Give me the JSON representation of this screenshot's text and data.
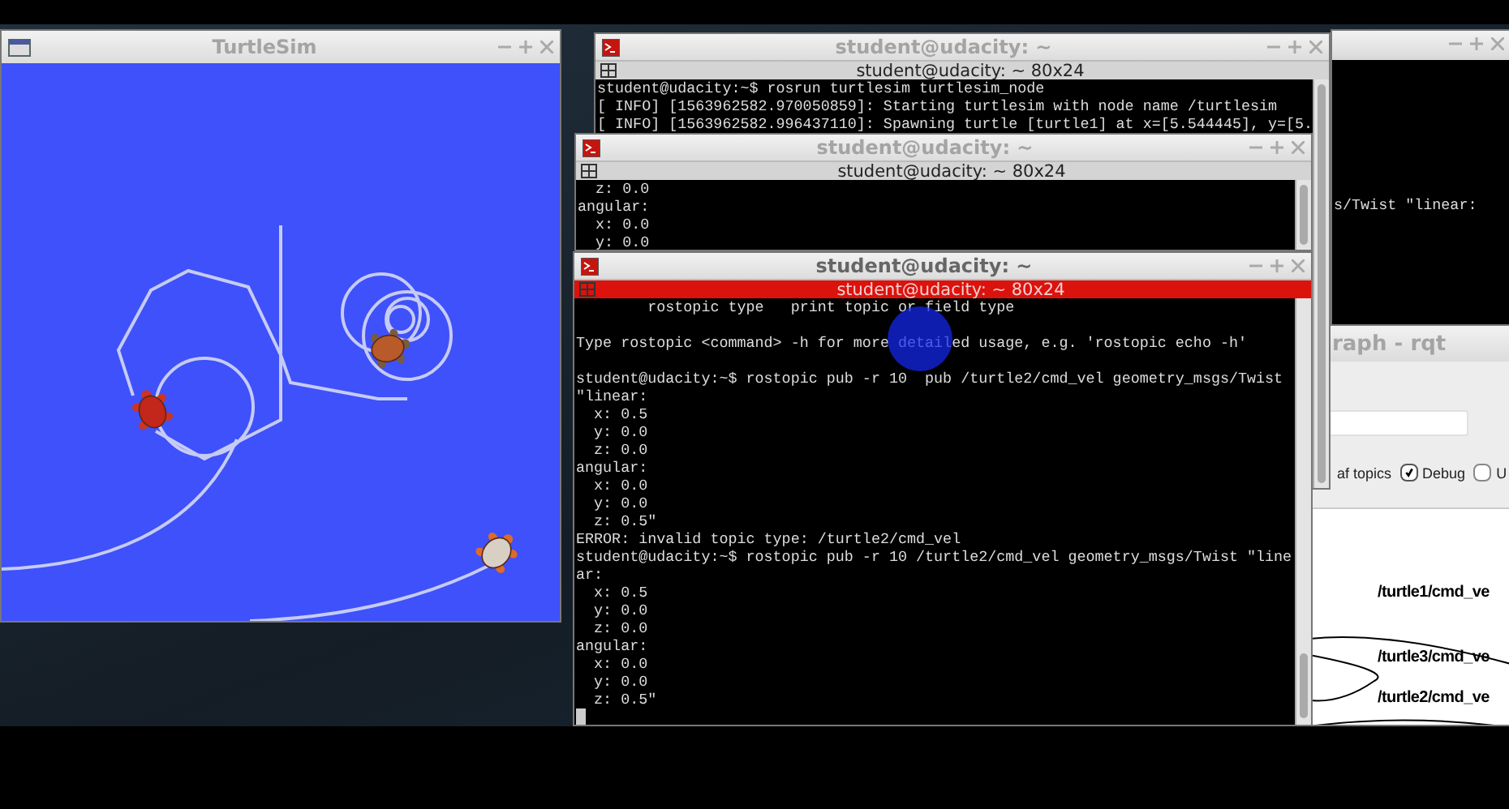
{
  "turtlesim": {
    "title": "TurtleSim",
    "focused": false
  },
  "background_terminal": {
    "lines": [
      "s/Twist \"linear:"
    ]
  },
  "rqt": {
    "title": "raph - rqt",
    "hide_label_partial": "af topics",
    "checkboxes": [
      {
        "label": "Debug",
        "checked": true
      },
      {
        "label": "U",
        "checked": false
      }
    ],
    "graph_nodes": [
      "/turtle1/cmd_ve",
      "/turtle3/cmd_ve",
      "/turtle2/cmd_ve"
    ]
  },
  "terminals": [
    {
      "title": "student@udacity: ~",
      "tab_title": "student@udacity: ~ 80x24",
      "focused": false,
      "paragraphs": [
        [
          "student@udacity:~$ rosrun turtlesim turtlesim_node",
          "[ INFO] [1563962582.970050859]: Starting turtlesim with node name /turtlesim",
          "[ INFO] [1563962582.996437110]: Spawning turtle [turtle1] at x=[5.544445], y=[5."
        ]
      ]
    },
    {
      "title": "student@udacity: ~",
      "tab_title": "student@udacity: ~ 80x24",
      "focused": false,
      "paragraphs": [
        [
          "  z: 0.0",
          "angular:",
          "  x: 0.0",
          "  y: 0.0"
        ]
      ]
    },
    {
      "title": "student@udacity: ~",
      "tab_title": "student@udacity: ~ 80x24",
      "focused": true,
      "paragraphs": [
        [
          "        rostopic type   print topic or field type"
        ],
        [
          "Type rostopic <command> -h for more detailed usage, e.g. 'rostopic echo -h'"
        ],
        [
          "student@udacity:~$ rostopic pub -r 10  pub /turtle2/cmd_vel geometry_msgs/Twist",
          "\"linear:",
          "  x: 0.5",
          "  y: 0.0",
          "  z: 0.0",
          "angular:",
          "  x: 0.0",
          "  y: 0.0",
          "  z: 0.5\"",
          "ERROR: invalid topic type: /turtle2/cmd_vel",
          "student@udacity:~$ rostopic pub -r 10 /turtle2/cmd_vel geometry_msgs/Twist \"line",
          "ar:",
          "  x: 0.5",
          "  y: 0.0",
          "  z: 0.0",
          "angular:",
          "  x: 0.0",
          "  y: 0.0",
          "  z: 0.5\""
        ]
      ]
    }
  ]
}
